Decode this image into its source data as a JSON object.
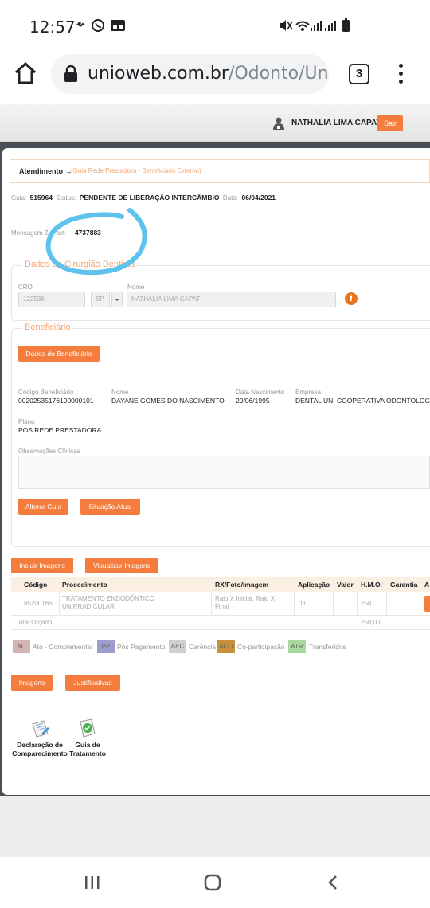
{
  "status_bar": {
    "time": "12:57"
  },
  "browser": {
    "url_domain": "unioweb.com.br",
    "url_path": "/Odonto/Uni",
    "tab_count": "3"
  },
  "header": {
    "user_name": "NATHALIA LIMA CAPATI",
    "logout_label": "Sair"
  },
  "breadcrumb": {
    "section": "Atendimento →",
    "page": "(Guia Rede Prestadora - Beneficiário Externo)"
  },
  "guide": {
    "guia_label": "Guia:",
    "guia_value": "515964",
    "status_label": "Status:",
    "status_value": "PENDENTE DE LIBERAÇÃO INTERCÂMBIO",
    "data_label": "Data:",
    "data_value": "06/04/2021",
    "mensagem_label": "Mensagem Z. Past:",
    "mensagem_value": "4737883"
  },
  "dentist": {
    "legend": "Dados do Cirurgião Dentista",
    "cro_label": "CRO",
    "cro_value": "122536",
    "uf_value": "SP",
    "nome_label": "Nome",
    "nome_value": "NATHALIA LIMA CAPATI"
  },
  "beneficiary": {
    "legend": "Beneficiário",
    "button": "Dados do Beneficiário",
    "codigo_label": "Código Beneficiário",
    "codigo_value": "00202535176100000101",
    "nome_label": "Nome",
    "nome_value": "DAYANE GOMES DO NASCIMENTO",
    "nasc_label": "Data Nascimento",
    "nasc_value": "29/06/1995",
    "empresa_label": "Empresa",
    "empresa_value": "DENTAL UNI COOPERATIVA ODONTOLOGI",
    "plano_label": "Plano",
    "plano_value": "POS REDE PRESTADORA",
    "obs_label": "Observações Clínicas"
  },
  "actions": {
    "alterar": "Alterar Guia",
    "situacao": "Situação Atual",
    "incluir": "Incluir Imagens",
    "visualizar": "Visualizar Imagens",
    "imagens": "Imagens",
    "justificativas": "Justificativas"
  },
  "table": {
    "headers": [
      "Código",
      "Procedimento",
      "RX/Foto/Imagem",
      "Aplicação",
      "Valor",
      "H.M.O.",
      "Garantia",
      "A"
    ],
    "row": {
      "codigo": "85200166",
      "procedimento": "TRATAMENTO ENDODÔNTICO UNIRRADICULAR",
      "rx": "Raio X Inicial, Raio X Final",
      "aplicacao": "11",
      "hmo": "258"
    },
    "total_label": "Total Orçado",
    "total_value": "258,00"
  },
  "legend_items": [
    {
      "code": "AC",
      "label": "Ato - Complementar",
      "color": "#d4b3b3"
    },
    {
      "code": "PP",
      "label": "Pós Pagamento",
      "color": "#9c9ccf"
    },
    {
      "code": "AEC",
      "label": "Carência",
      "color": "#cfcfcf"
    },
    {
      "code": "ACO",
      "label": "Co-participação",
      "color": "#c8903a"
    },
    {
      "code": "ATR",
      "label": "Transferidos",
      "color": "#a9d8a1"
    }
  ],
  "documents": {
    "declaracao": "Declaração de Comparecimento",
    "guia_tratamento": "Guia de Tratamento"
  },
  "colors": {
    "accent": "#f47c3c",
    "annotation": "#5ec3ec"
  }
}
